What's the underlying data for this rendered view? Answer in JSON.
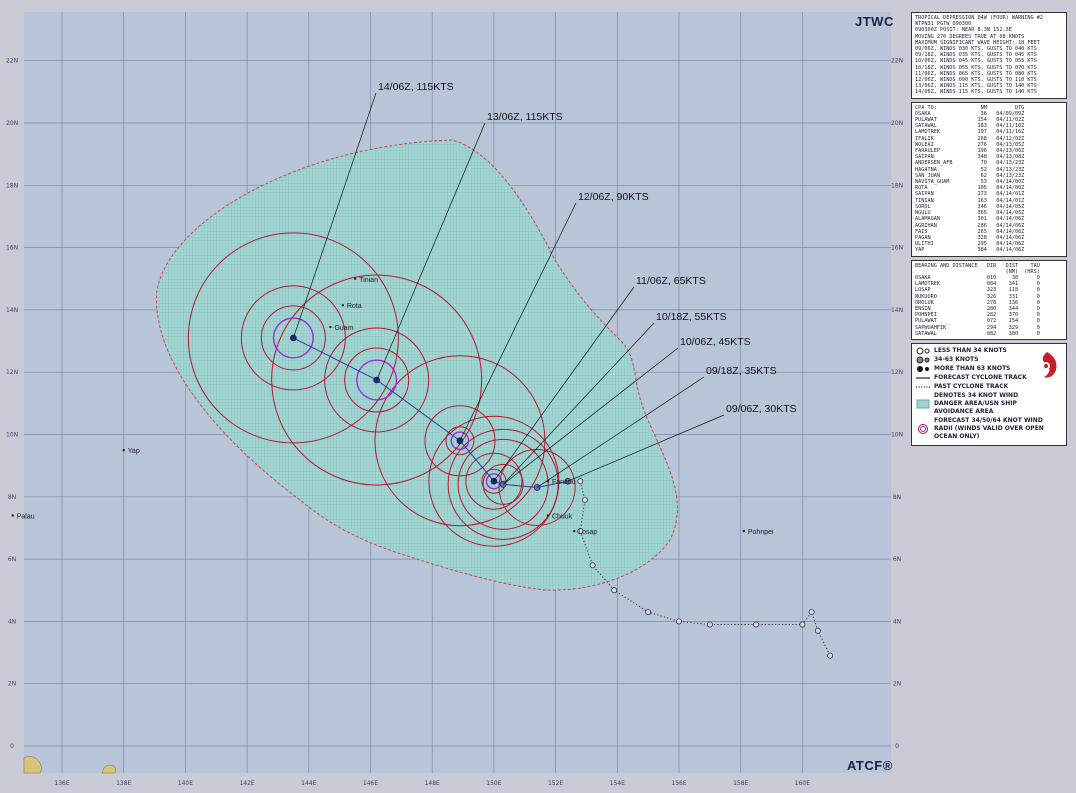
{
  "header": {
    "agency": "JTWC",
    "footer_tag": "ATCF®"
  },
  "latitudes": [
    {
      "value": 22,
      "label": "22N"
    },
    {
      "value": 20,
      "label": "20N"
    },
    {
      "value": 18,
      "label": "18N"
    },
    {
      "value": 16,
      "label": "16N"
    },
    {
      "value": 14,
      "label": "14N"
    },
    {
      "value": 12,
      "label": "12N"
    },
    {
      "value": 10,
      "label": "10N"
    },
    {
      "value": 8,
      "label": "8N"
    },
    {
      "value": 6,
      "label": "6N"
    },
    {
      "value": 4,
      "label": "4N"
    },
    {
      "value": 2,
      "label": "2N"
    },
    {
      "value": 0,
      "label": "0"
    }
  ],
  "longitudes": [
    {
      "value": 136,
      "label": "136E"
    },
    {
      "value": 138,
      "label": "138E"
    },
    {
      "value": 140,
      "label": "140E"
    },
    {
      "value": 142,
      "label": "142E"
    },
    {
      "value": 144,
      "label": "144E"
    },
    {
      "value": 146,
      "label": "146E"
    },
    {
      "value": 148,
      "label": "148E"
    },
    {
      "value": 150,
      "label": "150E"
    },
    {
      "value": 152,
      "label": "152E"
    },
    {
      "value": 154,
      "label": "154E"
    },
    {
      "value": 156,
      "label": "156E"
    },
    {
      "value": 158,
      "label": "158E"
    },
    {
      "value": 160,
      "label": "160E"
    }
  ],
  "colors": {
    "ocean": "#b8c5d9",
    "danger_area": "#9fd3d2",
    "danger_border": "#d0404a",
    "wind_radii": "#b8162c",
    "radii_64": "#a02ad8",
    "track": "#2c3f9a",
    "grid": "#7d8aa6"
  },
  "places": [
    {
      "name": "Tinian",
      "lat": 15.0,
      "lon": 145.6
    },
    {
      "name": "Rota",
      "lat": 14.15,
      "lon": 145.2
    },
    {
      "name": "Guam",
      "lat": 13.45,
      "lon": 144.8
    },
    {
      "name": "Yap",
      "lat": 9.5,
      "lon": 138.1
    },
    {
      "name": "Palau",
      "lat": 7.4,
      "lon": 134.5
    },
    {
      "name": "Fananu",
      "lat": 8.5,
      "lon": 151.85
    },
    {
      "name": "Chuuk",
      "lat": 7.4,
      "lon": 151.85
    },
    {
      "name": "Losap",
      "lat": 6.9,
      "lon": 152.7
    },
    {
      "name": "Pohnpei",
      "lat": 6.9,
      "lon": 158.2
    }
  ],
  "forecast_points": [
    {
      "label": "09/06Z, 30KTS",
      "lat": 8.5,
      "lon": 152.4,
      "kts": 30
    },
    {
      "label": "09/18Z, 35KTS",
      "lat": 8.3,
      "lon": 151.4,
      "kts": 35
    },
    {
      "label": "10/06Z, 45KTS",
      "lat": 8.4,
      "lon": 150.3,
      "kts": 45
    },
    {
      "label": "10/18Z, 55KTS",
      "lat": 8.4,
      "lon": 150.3,
      "kts": 55
    },
    {
      "label": "11/06Z, 65KTS",
      "lat": 8.5,
      "lon": 150.0,
      "kts": 65
    },
    {
      "label": "12/06Z, 90KTS",
      "lat": 9.8,
      "lon": 148.9,
      "kts": 90
    },
    {
      "label": "13/06Z, 115KTS",
      "lat": 11.75,
      "lon": 146.2,
      "kts": 115
    },
    {
      "label": "14/06Z, 115KTS",
      "lat": 13.1,
      "lon": 143.5,
      "kts": 115
    }
  ],
  "past_track": [
    {
      "lat": 8.5,
      "lon": 152.8
    },
    {
      "lat": 7.9,
      "lon": 152.95
    },
    {
      "lat": 6.9,
      "lon": 152.8
    },
    {
      "lat": 5.8,
      "lon": 153.2
    },
    {
      "lat": 5.0,
      "lon": 153.9
    },
    {
      "lat": 4.3,
      "lon": 155.0
    },
    {
      "lat": 4.0,
      "lon": 156.0
    },
    {
      "lat": 3.9,
      "lon": 157.0
    },
    {
      "lat": 3.9,
      "lon": 158.5
    },
    {
      "lat": 3.9,
      "lon": 160.0
    },
    {
      "lat": 4.3,
      "lon": 160.3
    },
    {
      "lat": 3.7,
      "lon": 160.5
    },
    {
      "lat": 2.9,
      "lon": 160.9
    }
  ],
  "warning": {
    "lines": [
      "TROPICAL DEPRESSION 04W (FOUR) WARNING #2",
      "WTPN31 PGTW 090300",
      "090300Z POSIT: NEAR 8.3N 152.3E",
      "MOVING 270 DEGREES TRUE AT 08 KNOTS",
      "MAXIMUM SIGNIFICANT WAVE HEIGHT: 18 FEET",
      "09/06Z, WINDS 030 KTS, GUSTS TO 040 KTS",
      "09/18Z, WINDS 035 KTS, GUSTS TO 045 KTS",
      "10/06Z, WINDS 045 KTS, GUSTS TO 055 KTS",
      "10/18Z, WINDS 055 KTS, GUSTS TO 070 KTS",
      "11/06Z, WINDS 065 KTS, GUSTS TO 080 KTS",
      "12/06Z, WINDS 090 KTS, GUSTS TO 110 KTS",
      "13/06Z, WINDS 115 KTS, GUSTS TO 140 KTS",
      "14/06Z, WINDS 115 KTS, GUSTS TO 140 KTS"
    ]
  },
  "cpa": {
    "header": [
      "CPA TO:",
      "NM",
      "DTG"
    ],
    "rows": [
      [
        "OSAKA",
        "36",
        "04/09/09Z"
      ],
      [
        "PULAWAT",
        "154",
        "04/11/02Z"
      ],
      [
        "SATAWAL",
        "183",
        "04/11/10Z"
      ],
      [
        "LAMOTREK",
        "197",
        "04/11/16Z"
      ],
      [
        "IFALIK",
        "268",
        "04/12/02Z"
      ],
      [
        "WOLEAI",
        "276",
        "04/13/05Z"
      ],
      [
        "FARAULEP",
        "196",
        "04/13/06Z"
      ],
      [
        "SAIPAN",
        "348",
        "04/13/08Z"
      ],
      [
        "ANDERSEN_AFB",
        "70",
        "04/13/23Z"
      ],
      [
        "HAGATNA",
        "52",
        "04/13/23Z"
      ],
      [
        "SAN_JUAN",
        "62",
        "04/13/23Z"
      ],
      [
        "NAVSTA_GUAM",
        "53",
        "04/14/00Z"
      ],
      [
        "ROTA",
        "105",
        "04/14/00Z"
      ],
      [
        "SAIPAN",
        "173",
        "04/14/01Z"
      ],
      [
        "TINIAN",
        "163",
        "04/14/01Z"
      ],
      [
        "SOROL",
        "346",
        "04/14/05Z"
      ],
      [
        "NGULU",
        "365",
        "04/14/05Z"
      ],
      [
        "ALAMAGAN",
        "301",
        "04/14/06Z"
      ],
      [
        "AGRIHAN",
        "286",
        "04/14/06Z"
      ],
      [
        "FAIS",
        "265",
        "04/14/06Z"
      ],
      [
        "PAGAN",
        "328",
        "04/14/06Z"
      ],
      [
        "ULITHI",
        "295",
        "04/14/06Z"
      ],
      [
        "YAP",
        "384",
        "04/14/06Z"
      ]
    ]
  },
  "bearing": {
    "header": [
      "BEARING AND DISTANCE",
      "DIR",
      "DIST",
      "TAU"
    ],
    "subheader": [
      "",
      "",
      "(NM)",
      "(HRS)"
    ],
    "rows": [
      [
        "OSAKA",
        "010",
        "38",
        "0"
      ],
      [
        "LAMOTREK",
        "084",
        "341",
        "0"
      ],
      [
        "LOSAP",
        "323",
        "118",
        "0"
      ],
      [
        "NUKUORO",
        "326",
        "331",
        "0"
      ],
      [
        "OROLUK",
        "278",
        "136",
        "0"
      ],
      [
        "ENSIN",
        "280",
        "344",
        "0"
      ],
      [
        "POHNPEI",
        "282",
        "370",
        "0"
      ],
      [
        "PULAWAT",
        "072",
        "154",
        "0"
      ],
      [
        "SAPWUAHFIK",
        "294",
        "329",
        "0"
      ],
      [
        "SATAWAL",
        "082",
        "380",
        "0"
      ]
    ]
  },
  "legend": {
    "items": [
      {
        "icon": "less-than-34-icon",
        "label": "LESS THAN 34 KNOTS"
      },
      {
        "icon": "34-63-icon",
        "label": "34-63 KNOTS"
      },
      {
        "icon": "more-than-63-icon",
        "label": "MORE THAN 63 KNOTS"
      },
      {
        "icon": "forecast-track-icon",
        "label": "FORECAST CYCLONE TRACK"
      },
      {
        "icon": "past-track-icon",
        "label": "PAST CYCLONE TRACK"
      },
      {
        "icon": "danger-area-icon",
        "label": "DENOTES 34 KNOT WIND DANGER AREA/USN SHIP AVOIDANCE AREA"
      },
      {
        "icon": "wind-radii-icon",
        "label": "FORECAST 34/50/64 KNOT WIND RADII (WINDS VALID OVER OPEN OCEAN ONLY)"
      }
    ]
  }
}
